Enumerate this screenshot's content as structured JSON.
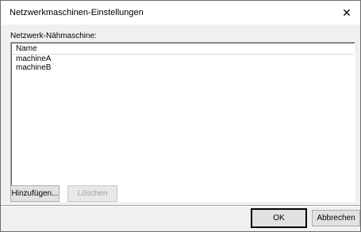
{
  "window": {
    "title": "Netzwerkmaschinen-Einstellungen",
    "close_glyph": "✕"
  },
  "group": {
    "label": "Netzwerk-Nähmaschine:"
  },
  "list": {
    "column_header": "Name",
    "rows": [
      "machineA",
      "machineB"
    ]
  },
  "buttons": {
    "add": "Hinzufügen...",
    "delete": "Löschen",
    "ok": "OK",
    "cancel": "Abbrechen"
  },
  "icons": {
    "close": "close-icon"
  }
}
